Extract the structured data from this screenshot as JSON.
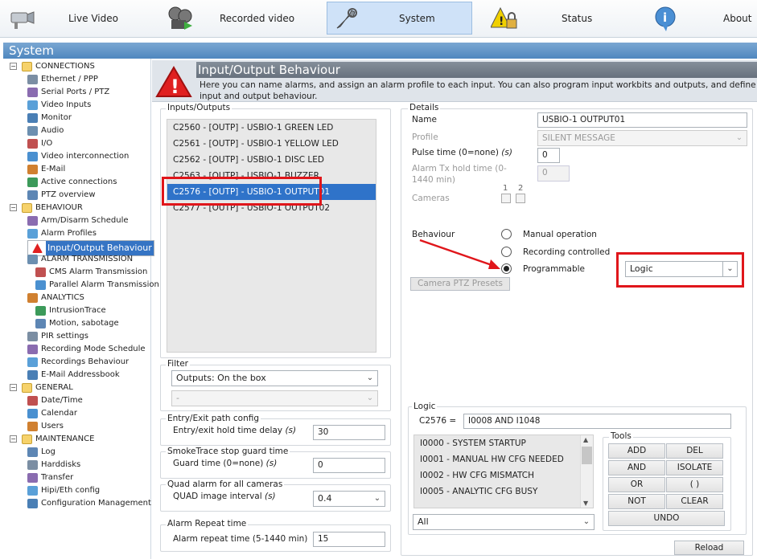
{
  "nav": {
    "items": [
      {
        "label": "Live Video",
        "icon": "camera-icon"
      },
      {
        "label": "Recorded video",
        "icon": "film-reel-icon"
      },
      {
        "label": "System",
        "icon": "wrench-icon",
        "active": true
      },
      {
        "label": "Status",
        "icon": "warning-lock-icon"
      },
      {
        "label": "About",
        "icon": "info-icon"
      }
    ]
  },
  "system_title": "System",
  "tree": [
    {
      "label": "CONNECTIONS",
      "level": 0,
      "folder": true
    },
    {
      "label": "Ethernet / PPP",
      "level": 1
    },
    {
      "label": "Serial Ports / PTZ",
      "level": 1
    },
    {
      "label": "Video Inputs",
      "level": 1
    },
    {
      "label": "Monitor",
      "level": 1
    },
    {
      "label": "Audio",
      "level": 1
    },
    {
      "label": "I/O",
      "level": 1
    },
    {
      "label": "Video interconnection",
      "level": 1
    },
    {
      "label": "E-Mail",
      "level": 1
    },
    {
      "label": "Active connections",
      "level": 1
    },
    {
      "label": "PTZ overview",
      "level": 1
    },
    {
      "label": "BEHAVIOUR",
      "level": 0,
      "folder": true
    },
    {
      "label": "Arm/Disarm Schedule",
      "level": 1
    },
    {
      "label": "Alarm Profiles",
      "level": 1
    },
    {
      "label": "Input/Output Behaviour",
      "level": 1,
      "selected": true
    },
    {
      "label": "ALARM TRANSMISSION",
      "level": 1
    },
    {
      "label": "CMS Alarm Transmission",
      "level": 2
    },
    {
      "label": "Parallel Alarm Transmission",
      "level": 2
    },
    {
      "label": "ANALYTICS",
      "level": 1
    },
    {
      "label": "IntrusionTrace",
      "level": 2
    },
    {
      "label": "Motion, sabotage",
      "level": 2
    },
    {
      "label": "PIR settings",
      "level": 1
    },
    {
      "label": "Recording Mode Schedule",
      "level": 1
    },
    {
      "label": "Recordings Behaviour",
      "level": 1
    },
    {
      "label": "E-Mail Addressbook",
      "level": 1
    },
    {
      "label": "GENERAL",
      "level": 0,
      "folder": true
    },
    {
      "label": "Date/Time",
      "level": 1
    },
    {
      "label": "Calendar",
      "level": 1
    },
    {
      "label": "Users",
      "level": 1
    },
    {
      "label": "MAINTENANCE",
      "level": 0,
      "folder": true
    },
    {
      "label": "Log",
      "level": 1
    },
    {
      "label": "Harddisks",
      "level": 1
    },
    {
      "label": "Transfer",
      "level": 1
    },
    {
      "label": "Hipi/Eth config",
      "level": 1
    },
    {
      "label": "Configuration Management",
      "level": 1
    }
  ],
  "header": {
    "title": "Input/Output Behaviour",
    "text": "Here you can name alarms, and assign an alarm profile to each input. You can also program input workbits and outputs, and define input and output behaviour."
  },
  "io": {
    "legend": "Inputs/Outputs",
    "items": [
      "C2560 - [OUTP] - USBIO-1 GREEN LED",
      "C2561 - [OUTP] - USBIO-1 YELLOW LED",
      "C2562 - [OUTP] - USBIO-1 DISC LED",
      "C2563 - [OUTP] - USBIO-1 BUZZER",
      "C2576 - [OUTP] - USBIO-1 OUTPUT01",
      "C2577 - [OUTP] - USBIO-1 OUTPUT02"
    ],
    "selected_index": 4
  },
  "filter": {
    "legend": "Filter",
    "value": "Outputs: On the box",
    "value2": "-"
  },
  "entry": {
    "legend": "Entry/Exit path config",
    "label": "Entry/exit hold time delay",
    "unit": "(s)",
    "value": "30"
  },
  "smoke": {
    "legend": "SmokeTrace stop guard time",
    "label": "Guard time (0=none)",
    "unit": "(s)",
    "value": "0"
  },
  "quad": {
    "legend": "Quad alarm for all cameras",
    "label": "QUAD image interval",
    "unit": "(s)",
    "value": "0.4"
  },
  "repeat": {
    "legend": "Alarm Repeat time",
    "label": "Alarm repeat time (5-1440 min)",
    "value": "15"
  },
  "details": {
    "legend": "Details",
    "name_label": "Name",
    "name_value": "USBIO-1 OUTPUT01",
    "profile_label": "Profile",
    "profile_value": "SILENT MESSAGE",
    "pulse_label": "Pulse time (0=none)",
    "pulse_unit": "(s)",
    "pulse_value": "0",
    "hold_label": "Alarm Tx hold time (0-1440 min)",
    "hold_value": "0",
    "cameras_label": "Cameras",
    "cam1": "1",
    "cam2": "2",
    "behaviour_label": "Behaviour",
    "options": [
      "Manual operation",
      "Recording controlled",
      "Programmable"
    ],
    "selected_option": 2,
    "mode_value": "Logic",
    "ptz_button": "Camera PTZ Presets"
  },
  "logic": {
    "legend": "Logic",
    "id": "C2576 =",
    "expr": "I0008 AND I1048",
    "items": [
      "I0000 - SYSTEM STARTUP",
      "I0001 - MANUAL HW CFG NEEDED",
      "I0002 - HW CFG MISMATCH",
      "I0005 - ANALYTIC CFG BUSY"
    ],
    "filter": "All",
    "tools_legend": "Tools",
    "tools": [
      "ADD",
      "DEL",
      "AND",
      "ISOLATE",
      "OR",
      "( )",
      "NOT",
      "CLEAR"
    ],
    "undo": "UNDO"
  },
  "reload": "Reload",
  "colors": {
    "accent": "#2f73c9",
    "highlight": "#e0161b"
  }
}
